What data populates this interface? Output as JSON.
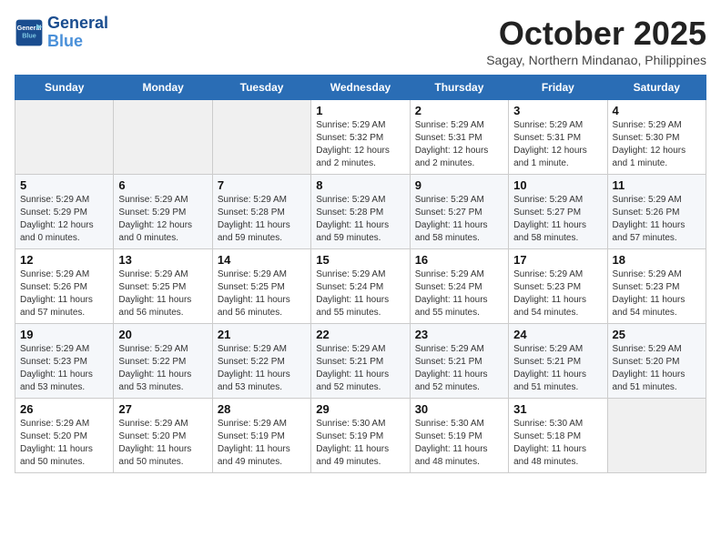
{
  "header": {
    "logo_line1": "General",
    "logo_line2": "Blue",
    "month": "October 2025",
    "location": "Sagay, Northern Mindanao, Philippines"
  },
  "weekdays": [
    "Sunday",
    "Monday",
    "Tuesday",
    "Wednesday",
    "Thursday",
    "Friday",
    "Saturday"
  ],
  "weeks": [
    [
      {
        "day": null
      },
      {
        "day": null
      },
      {
        "day": null
      },
      {
        "day": "1",
        "sunrise": "5:29 AM",
        "sunset": "5:32 PM",
        "daylight": "12 hours and 2 minutes."
      },
      {
        "day": "2",
        "sunrise": "5:29 AM",
        "sunset": "5:31 PM",
        "daylight": "12 hours and 2 minutes."
      },
      {
        "day": "3",
        "sunrise": "5:29 AM",
        "sunset": "5:31 PM",
        "daylight": "12 hours and 1 minute."
      },
      {
        "day": "4",
        "sunrise": "5:29 AM",
        "sunset": "5:30 PM",
        "daylight": "12 hours and 1 minute."
      }
    ],
    [
      {
        "day": "5",
        "sunrise": "5:29 AM",
        "sunset": "5:29 PM",
        "daylight": "12 hours and 0 minutes."
      },
      {
        "day": "6",
        "sunrise": "5:29 AM",
        "sunset": "5:29 PM",
        "daylight": "12 hours and 0 minutes."
      },
      {
        "day": "7",
        "sunrise": "5:29 AM",
        "sunset": "5:28 PM",
        "daylight": "11 hours and 59 minutes."
      },
      {
        "day": "8",
        "sunrise": "5:29 AM",
        "sunset": "5:28 PM",
        "daylight": "11 hours and 59 minutes."
      },
      {
        "day": "9",
        "sunrise": "5:29 AM",
        "sunset": "5:27 PM",
        "daylight": "11 hours and 58 minutes."
      },
      {
        "day": "10",
        "sunrise": "5:29 AM",
        "sunset": "5:27 PM",
        "daylight": "11 hours and 58 minutes."
      },
      {
        "day": "11",
        "sunrise": "5:29 AM",
        "sunset": "5:26 PM",
        "daylight": "11 hours and 57 minutes."
      }
    ],
    [
      {
        "day": "12",
        "sunrise": "5:29 AM",
        "sunset": "5:26 PM",
        "daylight": "11 hours and 57 minutes."
      },
      {
        "day": "13",
        "sunrise": "5:29 AM",
        "sunset": "5:25 PM",
        "daylight": "11 hours and 56 minutes."
      },
      {
        "day": "14",
        "sunrise": "5:29 AM",
        "sunset": "5:25 PM",
        "daylight": "11 hours and 56 minutes."
      },
      {
        "day": "15",
        "sunrise": "5:29 AM",
        "sunset": "5:24 PM",
        "daylight": "11 hours and 55 minutes."
      },
      {
        "day": "16",
        "sunrise": "5:29 AM",
        "sunset": "5:24 PM",
        "daylight": "11 hours and 55 minutes."
      },
      {
        "day": "17",
        "sunrise": "5:29 AM",
        "sunset": "5:23 PM",
        "daylight": "11 hours and 54 minutes."
      },
      {
        "day": "18",
        "sunrise": "5:29 AM",
        "sunset": "5:23 PM",
        "daylight": "11 hours and 54 minutes."
      }
    ],
    [
      {
        "day": "19",
        "sunrise": "5:29 AM",
        "sunset": "5:23 PM",
        "daylight": "11 hours and 53 minutes."
      },
      {
        "day": "20",
        "sunrise": "5:29 AM",
        "sunset": "5:22 PM",
        "daylight": "11 hours and 53 minutes."
      },
      {
        "day": "21",
        "sunrise": "5:29 AM",
        "sunset": "5:22 PM",
        "daylight": "11 hours and 53 minutes."
      },
      {
        "day": "22",
        "sunrise": "5:29 AM",
        "sunset": "5:21 PM",
        "daylight": "11 hours and 52 minutes."
      },
      {
        "day": "23",
        "sunrise": "5:29 AM",
        "sunset": "5:21 PM",
        "daylight": "11 hours and 52 minutes."
      },
      {
        "day": "24",
        "sunrise": "5:29 AM",
        "sunset": "5:21 PM",
        "daylight": "11 hours and 51 minutes."
      },
      {
        "day": "25",
        "sunrise": "5:29 AM",
        "sunset": "5:20 PM",
        "daylight": "11 hours and 51 minutes."
      }
    ],
    [
      {
        "day": "26",
        "sunrise": "5:29 AM",
        "sunset": "5:20 PM",
        "daylight": "11 hours and 50 minutes."
      },
      {
        "day": "27",
        "sunrise": "5:29 AM",
        "sunset": "5:20 PM",
        "daylight": "11 hours and 50 minutes."
      },
      {
        "day": "28",
        "sunrise": "5:29 AM",
        "sunset": "5:19 PM",
        "daylight": "11 hours and 49 minutes."
      },
      {
        "day": "29",
        "sunrise": "5:30 AM",
        "sunset": "5:19 PM",
        "daylight": "11 hours and 49 minutes."
      },
      {
        "day": "30",
        "sunrise": "5:30 AM",
        "sunset": "5:19 PM",
        "daylight": "11 hours and 48 minutes."
      },
      {
        "day": "31",
        "sunrise": "5:30 AM",
        "sunset": "5:18 PM",
        "daylight": "11 hours and 48 minutes."
      },
      {
        "day": null
      }
    ]
  ],
  "labels": {
    "sunrise_label": "Sunrise:",
    "sunset_label": "Sunset:",
    "daylight_label": "Daylight:"
  }
}
